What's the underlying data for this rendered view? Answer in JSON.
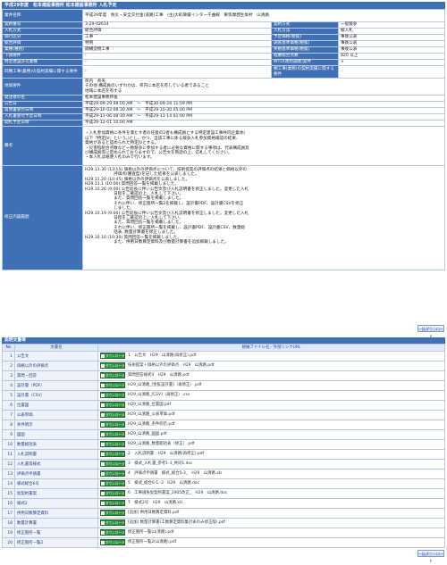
{
  "header": {
    "title": "平成29年度　松本建設事務所 松本建設事務所 入札予定"
  },
  "info": {
    "row1": {
      "label": "業件名称",
      "value": "平成29年度　防災・安全交付金(道路)工事　(主)大町麻績インター千曲線　東筑摩郡生坂村　山清路"
    },
    "row2": {
      "l1": "契約番号",
      "v1": "3-29-02614",
      "l2": "契約方式",
      "v2": "一般競争"
    },
    "row3": {
      "l1": "入札方式",
      "v1": "総合評価",
      "l2": "入札方法",
      "v2": "紙入札"
    },
    "row4": {
      "l1": "施行区分",
      "v1": "工事",
      "l2": "予定価格(税抜)",
      "v2": "事後公表"
    },
    "row5": {
      "l1": "総合評価",
      "v1": "特例",
      "l2": "調査基準価格(税抜)",
      "v2": "事後公表"
    },
    "row6": {
      "l1": "業種(種別)",
      "v1": "鋼構造物工事",
      "l2": "失格基準価格(税抜)",
      "v2": "事後公表"
    },
    "row7": {
      "l1": "下請要件",
      "v1": "-",
      "l2": "経審総合点数",
      "v2": "820 以上"
    },
    "row8": {
      "l1": "特定建設許可業種",
      "v1": "-",
      "l2": "WTO(政府調達)案件",
      "v2": "×"
    },
    "row9": {
      "l1": "同種工事(業務)の契約実績に関する要件",
      "v1": "-",
      "l2": "類工事(業務)の契約実績に関する要件",
      "v2": "-"
    },
    "row10": {
      "label": "地域要件",
      "lines": [
        "県内　県央",
        "その他 構成員のいずれかは、県内に本店を有している者であること",
        "地域に本店を有する"
      ]
    },
    "row11": {
      "label": "発注者の名",
      "value": "松本建設事務所長"
    },
    "row12": {
      "label": "公告日",
      "value": "平成29-09-29 08:00 AM　～　平成30-09-28 11:59 PM"
    },
    "row13": {
      "label": "質問書受付日時",
      "value": "平成29-10-02 08:30 AM　～　平成29-10-30 05:00 PM"
    },
    "row14": {
      "label": "入札書受付予定日時",
      "value": "平成29-11-06 08:30 AM　～　平成29-11-14 01:00 PM"
    },
    "row15": {
      "label": "開札予定日時",
      "value": "平成29-12-01 10:00 AM"
    },
    "remarks": {
      "label": "備考",
      "lines": [
        "・入札参加資格に条件を満たす者の任意の2者も構成員とする特定建設工事共同企業体(",
        "以下「特定JV」という。)とし、かつ、当該工事に係る競争入札参加資格確認の結果、",
        "資格があると認められた特定JVとする。",
        "・災害指組合点数など一致競争に参加する者に必要な資格に関する事項は、代表構成員及",
        "び構成員等に定められておりますので、公告文を熟読の上、応札してください。",
        "・本入札は紙便入札のみで行います。"
      ]
    },
    "history": {
      "label": "修正内容履歴",
      "lines": [
        "H29.11.30 (13:15) 価格以外の評価点について、技術提案の評価点の結果と価格以外の",
        "　　　　　　　評価点(審査型)を記した結果を公表しました。",
        "",
        "H29.11.20 (10:45) 価格以外の評価点を公表しました。",
        "",
        "H29.11.1 (10:00) 質問回答一覧を掲載しました。",
        "",
        "H29.10.26 (9:00) 公告延長に伴い公告文及び入札説明書を修正しました。変更した入札",
        "　　　　　　　日程をご確認の上、入札して下さい。",
        "　　　　　　　また、質問回答一覧を掲載しました。",
        "　　　　　　　それに伴い、修正箇所一覧2を掲載し、設計書PDF、設計書CSVを修正",
        "　　　　　　　しました。",
        "",
        "H29.10.19 (9:00) 公告延長に伴い公告文及び入札説明書を修正しました。変更した入札",
        "　　　　　　　日程をご確認の上、入札して下さい。",
        "　　　　　　　また、質問回答一覧を掲載しました。",
        "　　　　　　　それに伴い、修正箇所一覧を掲載し、設計書PDF、設計書CSV、数量総",
        "　　　　　　　括表, 数量計算書を修正しました。",
        "",
        "H29.10.10 (10:30) 質問回答一覧を掲載しました。",
        "　　　　　　　また、供用日数算定資料及び数量計算書を追加掲載しました。"
      ]
    }
  },
  "download_all_label": "一括ダウンロード",
  "docs_section": {
    "title": "説明文書等",
    "col_no": "No",
    "col_name": "文書名",
    "col_file": "格納ファイル名／外部リンクURL"
  },
  "download_label": "ダウンロード",
  "docs": [
    {
      "no": "1",
      "name": "公告文",
      "file": "1　公告文　H29　山清路(再修正).pdf"
    },
    {
      "no": "2",
      "name": "価格以外の評価点",
      "file": "技術提案＋価格以外の評価点　H29　山清路.pdf"
    },
    {
      "no": "3",
      "name": "質問・回答",
      "file": "質問回答様式4　H29　山清路.pdf"
    },
    {
      "no": "4",
      "name": "設計書（PDF）",
      "file": "H29_山清路_[金抜設計書]（再修正）.pdf"
    },
    {
      "no": "5",
      "name": "設計書（CSV）",
      "file": "H29_山清路_[CSV]（再修正）.csv"
    },
    {
      "no": "6",
      "name": "位置図",
      "file": "H29_山清路_位置図.pdf"
    },
    {
      "no": "7",
      "name": "公表単価",
      "file": "H29_山清路_公表単価.pdf"
    },
    {
      "no": "8",
      "name": "条件明示",
      "file": "H29_山清路_条件明示.pdf"
    },
    {
      "no": "9",
      "name": "図面",
      "file": "H29_山清路_図面.pdf"
    },
    {
      "no": "10",
      "name": "数量総括表",
      "file": "H29_山清路_数量総括表（修正）.pdf"
    },
    {
      "no": "11",
      "name": "入札説明書",
      "file": "2　入札説明書　H29　山清路(再修正).pdf"
    },
    {
      "no": "12",
      "name": "入札書等様式",
      "file": "3　様式_入札書_参考1-3_共同1.doc"
    },
    {
      "no": "13",
      "name": "評価点申請書",
      "file": "4　評価点申請書　様式_総合5-3_　H29　山清路.xls"
    },
    {
      "no": "14",
      "name": "様式総合6号",
      "file": "5　様式_総合6-1,-2　H29　山清路.doc"
    },
    {
      "no": "15",
      "name": "仮契約書案",
      "file": "6　工事請負仮契約書案_2905改正_　H29　山清路.doc"
    },
    {
      "no": "16",
      "name": "様式2",
      "file": "7　様式2号　H29　山清路.xls"
    },
    {
      "no": "17",
      "name": "供用日数算定資料",
      "file": "[追加] 供用日数算定資料.pdf"
    },
    {
      "no": "18",
      "name": "数量計算書",
      "file": "[追加] 数量計算書(工数算定資料集計表のみ修正版).pdf"
    },
    {
      "no": "19",
      "name": "修正箇所一覧",
      "file": "修正箇所一覧(山清路).pdf"
    },
    {
      "no": "20",
      "name": "修正箇所一覧2",
      "file": "修正箇所一覧2(山清路).pdf"
    }
  ]
}
